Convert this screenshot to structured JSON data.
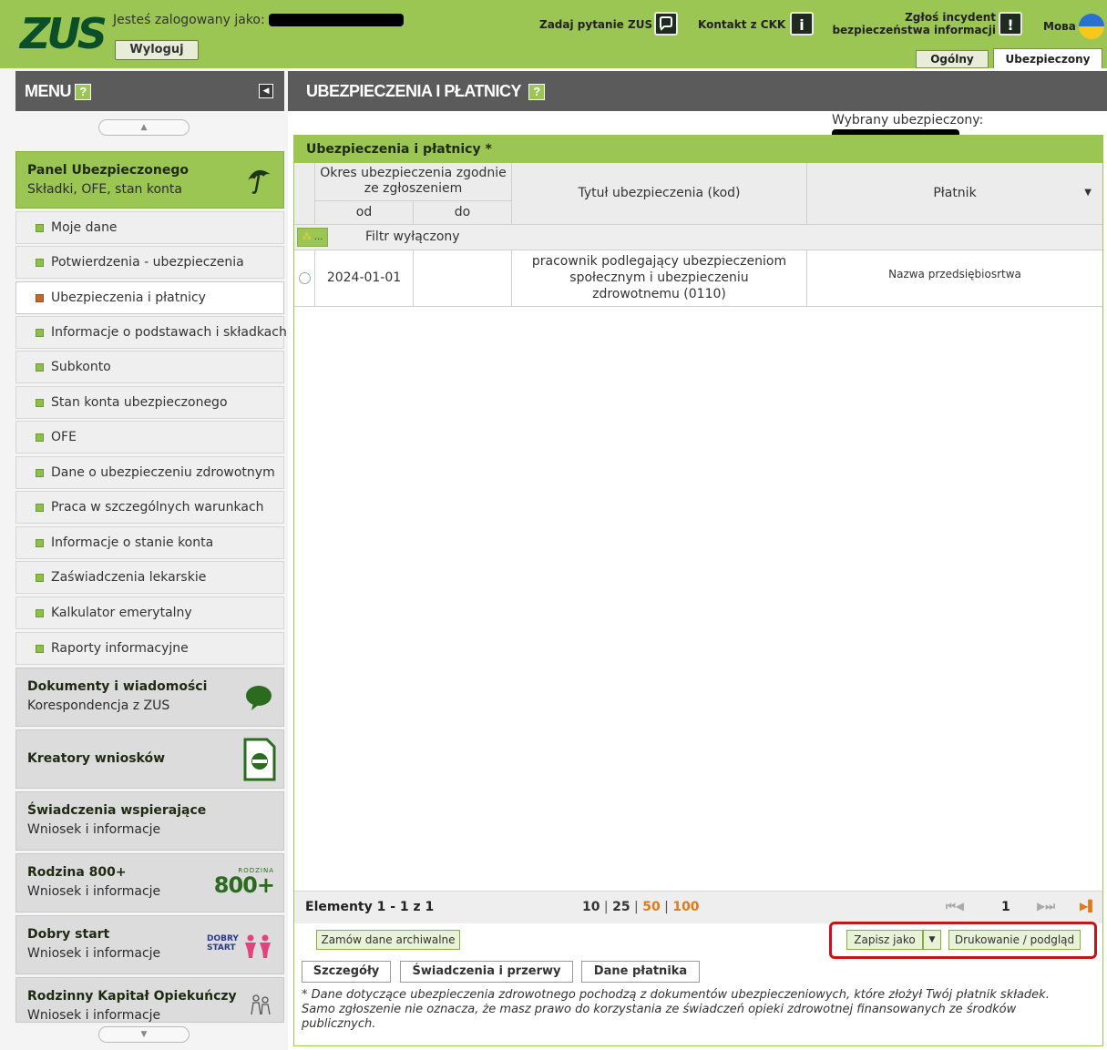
{
  "header": {
    "logo": "ZUS",
    "logged_as": "Jesteś zalogowany jako:",
    "logout": "Wyloguj",
    "ask_question": "Zadaj pytanie ZUS",
    "contact": "Kontakt z CKK",
    "incident_line1": "Zgłoś incydent",
    "incident_line2": "bezpieczeństwa informacji",
    "language": "Мова",
    "tab_general": "Ogólny",
    "tab_insured": "Ubezpieczony"
  },
  "sidebar": {
    "menu_title": "MENU",
    "help": "?",
    "panel": {
      "title": "Panel Ubezpieczonego",
      "subtitle": "Składki, OFE, stan konta"
    },
    "items": [
      {
        "label": "Moje dane"
      },
      {
        "label": "Potwierdzenia - ubezpieczenia"
      },
      {
        "label": "Ubezpieczenia i płatnicy"
      },
      {
        "label": "Informacje o podstawach i składkach"
      },
      {
        "label": "Subkonto"
      },
      {
        "label": "Stan konta ubezpieczonego"
      },
      {
        "label": "OFE"
      },
      {
        "label": "Dane o ubezpieczeniu zdrowotnym"
      },
      {
        "label": "Praca w szczególnych warunkach"
      },
      {
        "label": "Informacje o stanie konta"
      },
      {
        "label": "Zaświadczenia lekarskie"
      },
      {
        "label": "Kalkulator emerytalny"
      },
      {
        "label": "Raporty informacyjne"
      }
    ],
    "sections": [
      {
        "title": "Dokumenty i wiadomości",
        "subtitle": "Korespondencja z ZUS"
      },
      {
        "title": "Kreatory wniosków",
        "subtitle": ""
      },
      {
        "title": "Świadczenia wspierające",
        "subtitle": "Wniosek i informacje"
      },
      {
        "title": "Rodzina 800+",
        "subtitle": "Wniosek i informacje"
      },
      {
        "title": "Dobry start",
        "subtitle": "Wniosek i informacje"
      },
      {
        "title": "Rodzinny Kapitał Opiekuńczy",
        "subtitle": "Wniosek i informacje"
      }
    ],
    "badge_800_small": "RODZINA",
    "badge_800": "800+",
    "badge_dobry": "DOBRY",
    "badge_start": "START"
  },
  "main": {
    "title": "UBEZPIECZENIA I PŁATNICY",
    "help": "?",
    "selected_label": "Wybrany ubezpieczony:",
    "box_title": "Ubezpieczenia i płatnicy *",
    "columns": {
      "period": "Okres ubezpieczenia zgodnie ze zgłoszeniem",
      "from": "od",
      "to": "do",
      "title": "Tytuł ubezpieczenia (kod)",
      "payer": "Płatnik"
    },
    "filter_button": "...",
    "filter_label": "Filtr wyłączony",
    "rows": [
      {
        "from": "2024-01-01",
        "to": "",
        "title": "pracownik podlegający ubezpieczeniom społecznym i ubezpieczeniu zdrowotnemu (0110)",
        "payer": "Nazwa przedsiębiosrtwa"
      }
    ],
    "pager": {
      "elements": "Elementy 1 - 1 z 1",
      "sizes": [
        "10",
        "25",
        "50",
        "100"
      ],
      "page": "1"
    },
    "buttons": {
      "archive": "Zamów dane archiwalne",
      "save_as": "Zapisz jako",
      "print": "Drukowanie / podgląd",
      "details": "Szczegóły",
      "benefits": "Świadczenia i przerwy",
      "payer_data": "Dane płatnika"
    },
    "note": "* Dane dotyczące ubezpieczenia zdrowotnego pochodzą z dokumentów ubezpieczeniowych, które złożył Twój płatnik składek. Samo zgłoszenie nie oznacza, że masz prawo do korzystania ze świadczeń opieki zdrowotnej finansowanych ze środków publicznych."
  },
  "colors": {
    "brand_green": "#9cc653",
    "header_gray": "#5b5b5b",
    "highlight_red": "#c4141c",
    "pager_orange": "#e07a16"
  }
}
